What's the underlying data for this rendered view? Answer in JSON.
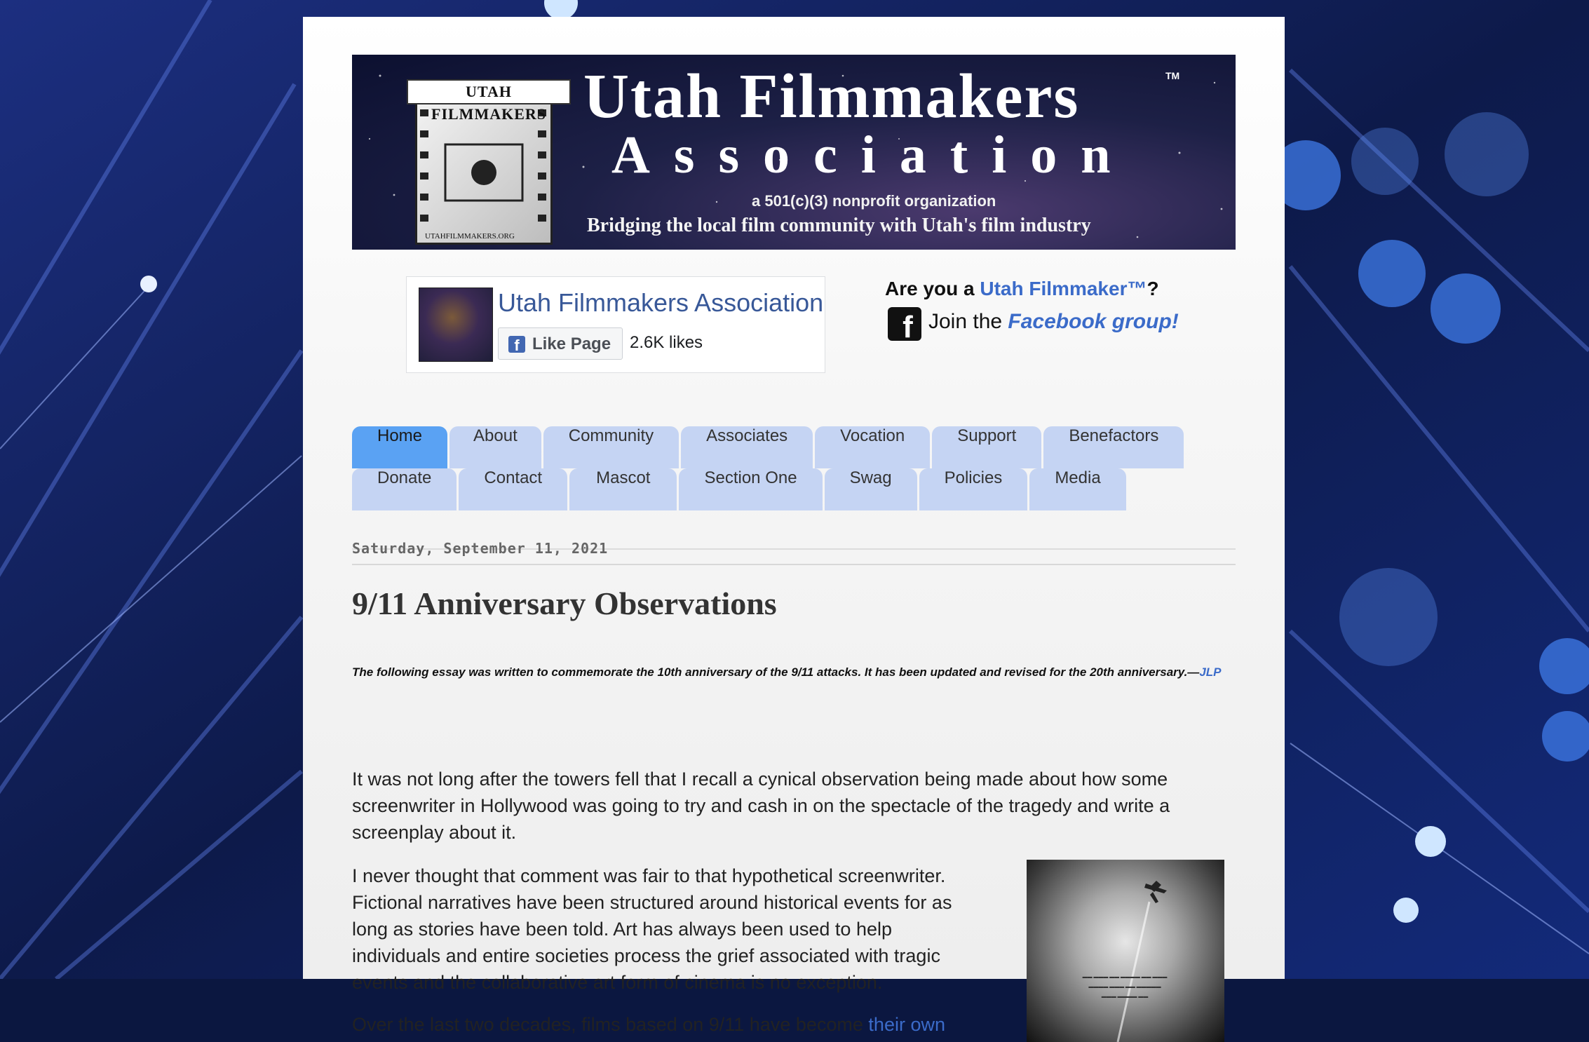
{
  "banner": {
    "logo_label": "UTAH FILMMAKERS",
    "logo_url": "UTAHFILMMAKERS.ORG",
    "title": "Utah Filmmakers",
    "trademark": "TM",
    "subtitle": "Association",
    "nonprofit": "a 501(c)(3) nonprofit organization",
    "tagline": "Bridging the local film community with Utah's film industry"
  },
  "facebook_widget": {
    "page_name": "Utah Filmmakers Association",
    "like_button": "Like Page",
    "likes": "2.6K likes"
  },
  "cta": {
    "question_prefix": "Are you a ",
    "question_link": "Utah Filmmaker™",
    "question_suffix": "?",
    "join_prefix": "Join the ",
    "join_link": "Facebook group!"
  },
  "nav": {
    "row1": [
      "Home",
      "About",
      "Community",
      "Associates",
      "Vocation",
      "Support",
      "Benefactors"
    ],
    "row2": [
      "Donate",
      "Contact",
      "Mascot",
      "Section One",
      "Swag",
      "Policies",
      "Media"
    ],
    "active": "Home"
  },
  "post": {
    "date": "Saturday, September 11, 2021",
    "title": "9/11 Anniversary Observations",
    "intro": "The following essay was written to commemorate the 10th anniversary of the 9/11 attacks. It has been updated and revised for the 20th anniversary.—",
    "intro_author": "JLP",
    "paragraph1": "It was not long after the towers fell that I recall a cynical observation being made about how some screenwriter in Hollywood was going to try and cash in on the spectacle of the tragedy and write a screenplay about it.",
    "paragraph2": "I never thought that comment was fair to that hypothetical screenwriter. Fictional narratives have been structured around historical events for as long as stories have been told. Art has always been used to help individuals and entire societies process the grief associated with tragic events and the collaborative art form of cinema is no exception.",
    "paragraph3_start": "Over the last two decades, films based on 9/11 have become ",
    "paragraph3_link": "their own"
  },
  "colors": {
    "tab": "#c5d4f3",
    "tab_active": "#5aa2f3",
    "link": "#3b6bc9",
    "fb_blue": "#385898"
  },
  "icons": {
    "fb_like": "facebook-f-icon",
    "fb_group": "facebook-square-icon"
  }
}
